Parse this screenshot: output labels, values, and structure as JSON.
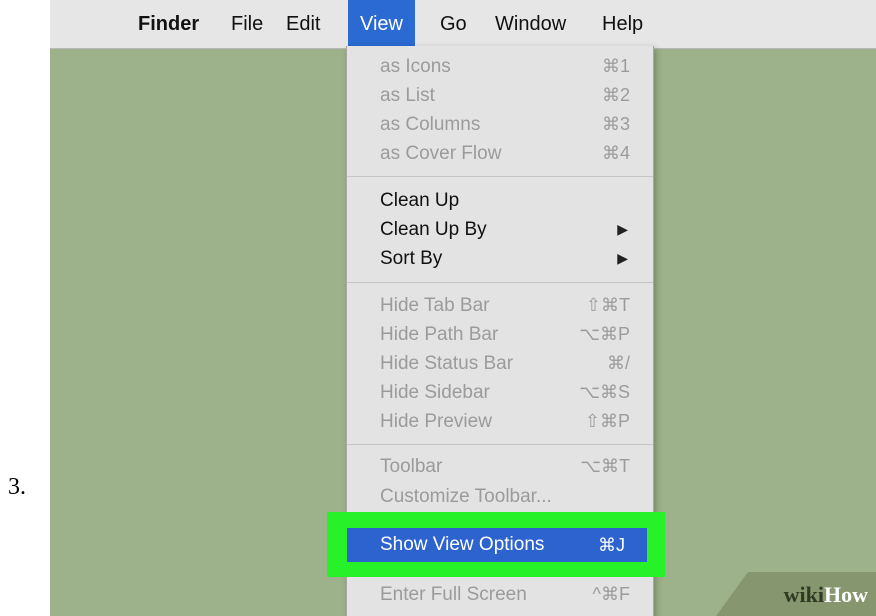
{
  "step": "3.",
  "menubar": {
    "apple": "",
    "items": [
      "Finder",
      "File",
      "Edit",
      "View",
      "Go",
      "Window",
      "Help"
    ]
  },
  "menu": {
    "group1": [
      {
        "label": "as Icons",
        "shortcut": "⌘1"
      },
      {
        "label": "as List",
        "shortcut": "⌘2"
      },
      {
        "label": "as Columns",
        "shortcut": "⌘3"
      },
      {
        "label": "as Cover Flow",
        "shortcut": "⌘4"
      }
    ],
    "group2": [
      {
        "label": "Clean Up"
      },
      {
        "label": "Clean Up By",
        "arrow": "▶"
      },
      {
        "label": "Sort By",
        "arrow": "▶"
      }
    ],
    "group3": [
      {
        "label": "Hide Tab Bar",
        "shortcut": "⇧⌘T"
      },
      {
        "label": "Hide Path Bar",
        "shortcut": "⌥⌘P"
      },
      {
        "label": "Hide Status Bar",
        "shortcut": "⌘/"
      },
      {
        "label": "Hide Sidebar",
        "shortcut": "⌥⌘S"
      },
      {
        "label": "Hide Preview",
        "shortcut": "⇧⌘P"
      }
    ],
    "group4": [
      {
        "label": "Toolbar",
        "shortcut": "⌥⌘T"
      },
      {
        "label": "Customize Toolbar..."
      }
    ],
    "highlighted": {
      "label": "Show View Options",
      "shortcut": "⌘J"
    },
    "group5": [
      {
        "label": "Enter Full Screen",
        "shortcut": "^⌘F"
      }
    ]
  },
  "watermark": {
    "wiki": "wiki",
    "how": "How"
  },
  "colors": {
    "highlight_border": "#27f229",
    "selection": "#2c63cf",
    "desktop": "#9db18a"
  }
}
